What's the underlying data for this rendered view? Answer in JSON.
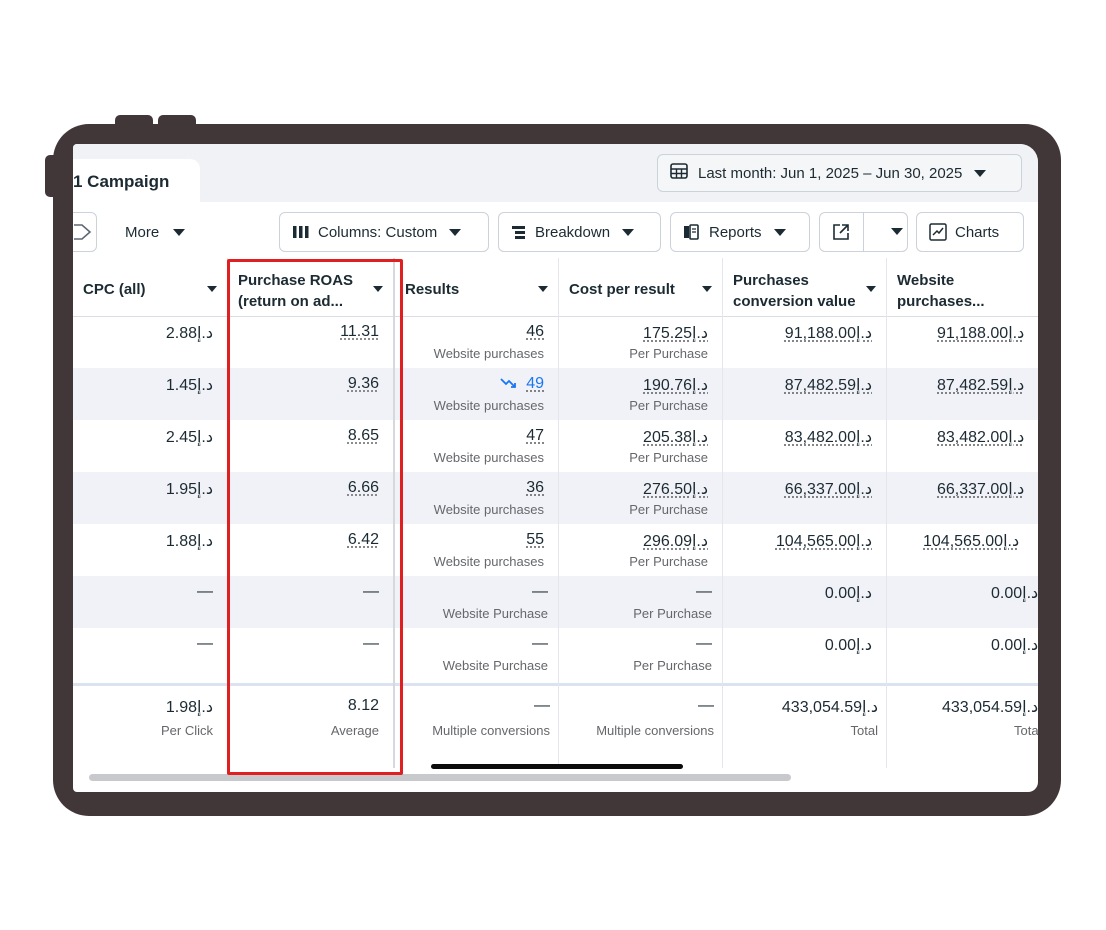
{
  "header": {
    "campaign_tab": "1 Campaign",
    "date_range": "Last month: Jun 1, 2025 – Jun 30, 2025"
  },
  "toolbar": {
    "more": "More",
    "columns": "Columns: Custom",
    "breakdown": "Breakdown",
    "reports": "Reports",
    "charts": "Charts"
  },
  "table": {
    "columns": [
      {
        "line1": "CPC (all)",
        "line2": ""
      },
      {
        "line1": "Purchase ROAS",
        "line2": "(return on ad..."
      },
      {
        "line1": "Results",
        "line2": ""
      },
      {
        "line1": "Cost per result",
        "line2": ""
      },
      {
        "line1": "Purchases",
        "line2": "conversion value"
      },
      {
        "line1": "Website",
        "line2": "purchases..."
      }
    ],
    "rows": [
      {
        "cpc": "2.88د.إ",
        "roas": "11.31",
        "results": "46",
        "results_sub": "Website purchases",
        "cost": "175.25د.إ",
        "cost_sub": "Per Purchase",
        "pcv": "91,188.00د.إ",
        "wp": "91,188.00د.إ"
      },
      {
        "cpc": "1.45د.إ",
        "roas": "9.36",
        "results": "49",
        "results_sub": "Website purchases",
        "cost": "190.76د.إ",
        "cost_sub": "Per Purchase",
        "pcv": "87,482.59د.إ",
        "wp": "87,482.59د.إ"
      },
      {
        "cpc": "2.45د.إ",
        "roas": "8.65",
        "results": "47",
        "results_sub": "Website purchases",
        "cost": "205.38د.إ",
        "cost_sub": "Per Purchase",
        "pcv": "83,482.00د.إ",
        "wp": "83,482.00د.إ"
      },
      {
        "cpc": "1.95د.إ",
        "roas": "6.66",
        "results": "36",
        "results_sub": "Website purchases",
        "cost": "276.50د.إ",
        "cost_sub": "Per Purchase",
        "pcv": "66,337.00د.إ",
        "wp": "66,337.00د.إ"
      },
      {
        "cpc": "1.88د.إ",
        "roas": "6.42",
        "results": "55",
        "results_sub": "Website purchases",
        "cost": "296.09د.إ",
        "cost_sub": "Per Purchase",
        "pcv": "104,565.00د.إ",
        "wp": "104,565.00د.إ"
      },
      {
        "cpc": "—",
        "roas": "—",
        "results": "—",
        "results_sub": "Website Purchase",
        "cost": "—",
        "cost_sub": "Per Purchase",
        "pcv": "0.00د.إ",
        "wp": "0.00د.إ"
      },
      {
        "cpc": "—",
        "roas": "—",
        "results": "—",
        "results_sub": "Website Purchase",
        "cost": "—",
        "cost_sub": "Per Purchase",
        "pcv": "0.00د.إ",
        "wp": "0.00د.إ"
      }
    ],
    "summary": {
      "cpc": "1.98د.إ",
      "cpc_sub": "Per Click",
      "roas": "8.12",
      "roas_sub": "Average",
      "results": "—",
      "results_sub": "Multiple conversions",
      "cost": "—",
      "cost_sub": "Multiple conversions",
      "pcv": "433,054.59د.إ",
      "pcv_sub": "Total",
      "wp": "433,054.59د.إ",
      "wp_sub": "Total"
    }
  },
  "colors": {
    "frame": "#413739",
    "highlight": "#e02020",
    "row_alt": "#f0f2f7",
    "link_blue": "#1877f2"
  },
  "icons": [
    "table-calendar-icon",
    "columns-icon",
    "breakdown-icon",
    "reports-icon",
    "export-icon",
    "chart-line-icon",
    "trend-down-icon",
    "caret-down-icon"
  ]
}
